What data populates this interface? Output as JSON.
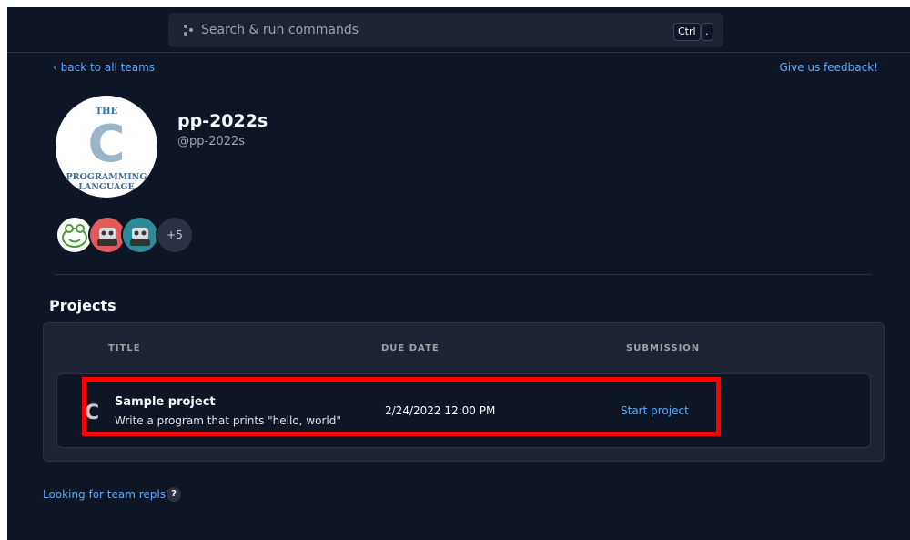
{
  "search": {
    "placeholder": "Search & run commands",
    "shortcut_keys": [
      "Ctrl",
      "."
    ]
  },
  "nav": {
    "back_label": "back to all teams",
    "feedback_label": "Give us feedback!"
  },
  "team": {
    "name": "pp-2022s",
    "handle": "@pp-2022s",
    "logo": {
      "line1": "THE",
      "letter": "C",
      "line2": "PROGRAMMING",
      "line3": "LANGUAGE"
    },
    "members_more": "+5"
  },
  "projects": {
    "section_title": "Projects",
    "columns": [
      "TITLE",
      "DUE DATE",
      "SUBMISSION"
    ],
    "rows": [
      {
        "icon_letter": "C",
        "title": "Sample project",
        "description": "Write a program that prints \"hello, world\"",
        "due_date": "2/24/2022 12:00 PM",
        "action": "Start project"
      }
    ]
  },
  "footer": {
    "team_repls_label": "Looking for team repls?",
    "help_symbol": "?"
  },
  "colors": {
    "background": "#0e1525",
    "panel": "#1c2333",
    "link": "#57abff",
    "highlight": "#ff0000"
  }
}
